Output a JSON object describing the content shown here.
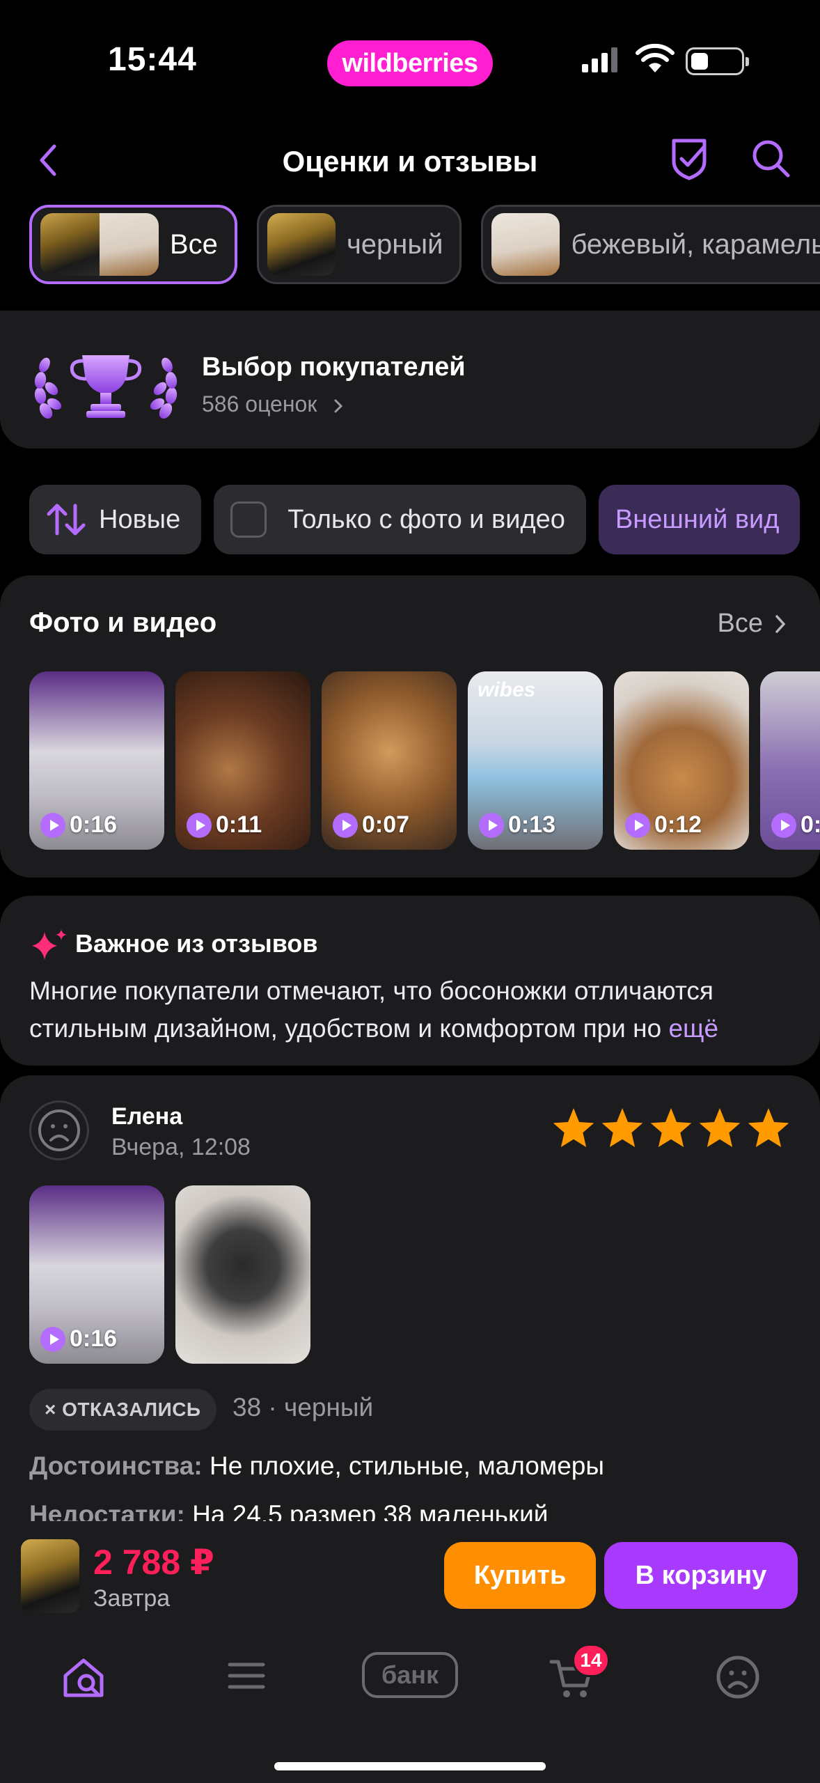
{
  "status_bar": {
    "time": "15:44",
    "brand": "wildberries"
  },
  "header": {
    "title": "Оценки и отзывы"
  },
  "variants": [
    {
      "label": "Все",
      "active": true
    },
    {
      "label": "черный",
      "active": false
    },
    {
      "label": "бежевый, карамель",
      "active": false
    }
  ],
  "choice": {
    "title": "Выбор покупателей",
    "subtitle": "586 оценок"
  },
  "filters": {
    "sort_label": "Новые",
    "photo_only_label": "Только с фото и видео",
    "aspect_label": "Внешний вид"
  },
  "media": {
    "title": "Фото и видео",
    "all_label": "Все",
    "badge_text": "wibes",
    "items": [
      {
        "duration": "0:16"
      },
      {
        "duration": "0:11"
      },
      {
        "duration": "0:07"
      },
      {
        "duration": "0:13"
      },
      {
        "duration": "0:12"
      },
      {
        "duration": "0:"
      }
    ]
  },
  "summary": {
    "title": "Важное из отзывов",
    "text": "Многие покупатели отмечают, что босоножки отличаются стильным дизайном, удобством и комфортом при но",
    "more": "ещё"
  },
  "review": {
    "author": "Елена",
    "date": "Вчера, 12:08",
    "rating": 5,
    "video_duration": "0:16",
    "tag": "× ОТКАЗАЛИСЬ",
    "variant_info": "38 · черный",
    "pros_label": "Достоинства:",
    "pros_text": "Не плохие, стильные, маломеры",
    "cons_label": "Недостатки:",
    "cons_text": "На 24,5 размер 38 маленький"
  },
  "buy_bar": {
    "price": "2 788 ₽",
    "delivery": "Завтра",
    "buy_label": "Купить",
    "cart_label": "В корзину"
  },
  "tab_bar": {
    "bank_label": "банк",
    "cart_count": "14"
  },
  "colors": {
    "accent": "#b46cff",
    "brand": "#ff1fd1",
    "price": "#ff1f5a",
    "buy": "#ff8f00",
    "cart": "#a73afd",
    "star": "#ff9a00"
  }
}
